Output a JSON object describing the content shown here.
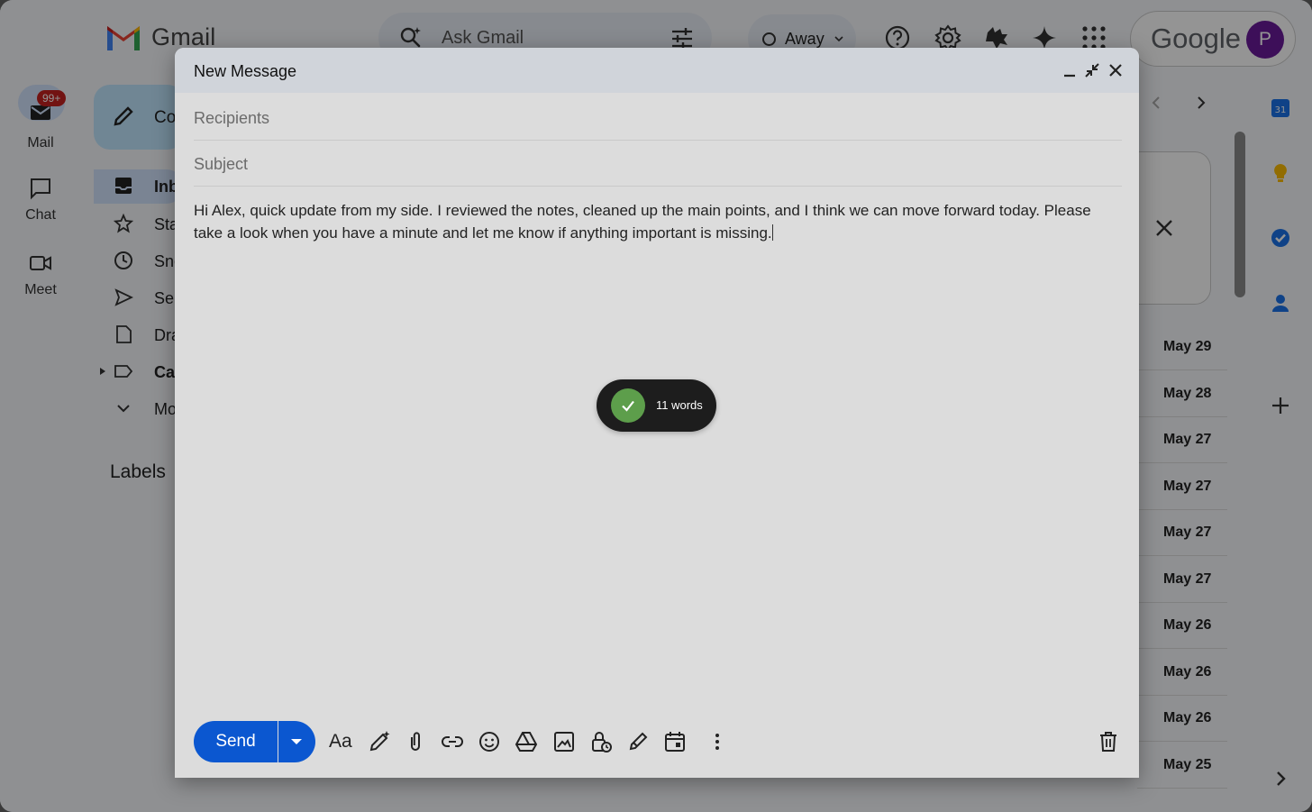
{
  "app": {
    "product_name": "Gmail",
    "search_placeholder": "Ask Gmail",
    "status_label": "Away",
    "google_word": "Google",
    "avatar_initial": "P"
  },
  "rail": {
    "mail_label": "Mail",
    "mail_badge": "99+",
    "chat_label": "Chat",
    "meet_label": "Meet"
  },
  "nav": {
    "compose_label": "Co",
    "items": [
      {
        "label": "Inb",
        "icon": "inbox-icon"
      },
      {
        "label": "Sta",
        "icon": "star-icon"
      },
      {
        "label": "Sno",
        "icon": "clock-icon"
      },
      {
        "label": "Sei",
        "icon": "send-icon"
      },
      {
        "label": "Dra",
        "icon": "draft-icon"
      },
      {
        "label": "Ca",
        "icon": "label-icon"
      },
      {
        "label": "Mo",
        "icon": "chevron-down-icon"
      }
    ],
    "labels_heading": "Labels"
  },
  "email_list": {
    "dates": [
      "May 29",
      "May 28",
      "May 27",
      "May 27",
      "May 27",
      "May 27",
      "May 26",
      "May 26",
      "May 26",
      "May 25"
    ]
  },
  "compose": {
    "title": "New Message",
    "recipients_placeholder": "Recipients",
    "subject_placeholder": "Subject",
    "body": "Hi Alex, quick update from my side. I reviewed the notes, cleaned up the main points, and I think we can move forward today. Please take a look when you have a minute and let me know if anything important is missing.",
    "send_label": "Send",
    "word_count_label": "11 words",
    "format_label": "Aa"
  },
  "colors": {
    "send_blue": "#0b57d0",
    "toast_bg": "#1d1d1d",
    "check_green": "#5d9e4b",
    "badge_red": "#c5221f"
  }
}
